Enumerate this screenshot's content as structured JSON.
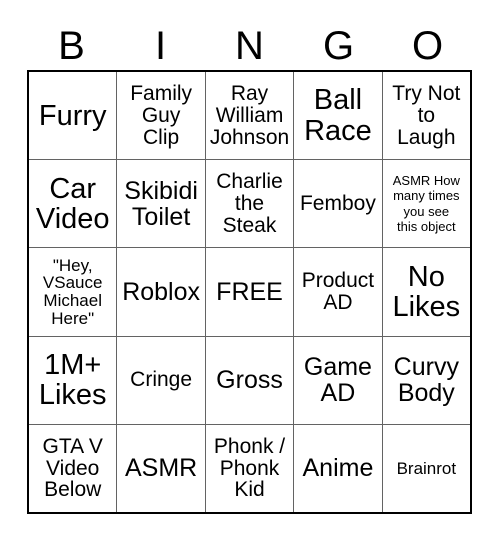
{
  "card": {
    "header_letters": [
      "B",
      "I",
      "N",
      "G",
      "O"
    ],
    "rows": [
      [
        {
          "label": "Furry",
          "size": "xl"
        },
        {
          "label": "Family\nGuy\nClip",
          "size": "md"
        },
        {
          "label": "Ray\nWilliam\nJohnson",
          "size": "md"
        },
        {
          "label": "Ball\nRace",
          "size": "xl"
        },
        {
          "label": "Try Not\nto\nLaugh",
          "size": "md"
        }
      ],
      [
        {
          "label": "Car\nVideo",
          "size": "xl"
        },
        {
          "label": "Skibidi\nToilet",
          "size": "lg"
        },
        {
          "label": "Charlie\nthe\nSteak",
          "size": "md"
        },
        {
          "label": "Femboy",
          "size": "md"
        },
        {
          "label": "ASMR How\nmany times\nyou see\nthis object",
          "size": "xs"
        }
      ],
      [
        {
          "label": "\"Hey,\nVSauce\nMichael\nHere\"",
          "size": "sm"
        },
        {
          "label": "Roblox",
          "size": "lg"
        },
        {
          "label": "FREE",
          "size": "lg"
        },
        {
          "label": "Product\nAD",
          "size": "md"
        },
        {
          "label": "No\nLikes",
          "size": "xl"
        }
      ],
      [
        {
          "label": "1M+\nLikes",
          "size": "xl"
        },
        {
          "label": "Cringe",
          "size": "md"
        },
        {
          "label": "Gross",
          "size": "lg"
        },
        {
          "label": "Game\nAD",
          "size": "lg"
        },
        {
          "label": "Curvy\nBody",
          "size": "lg"
        }
      ],
      [
        {
          "label": "GTA V\nVideo\nBelow",
          "size": "md"
        },
        {
          "label": "ASMR",
          "size": "lg"
        },
        {
          "label": "Phonk /\nPhonk\nKid",
          "size": "md"
        },
        {
          "label": "Anime",
          "size": "lg"
        },
        {
          "label": "Brainrot",
          "size": "sm"
        }
      ]
    ]
  },
  "colors": {
    "text": "#000000",
    "outer_border": "#000000",
    "inner_grid_line": "#636363",
    "background": "#ffffff"
  }
}
